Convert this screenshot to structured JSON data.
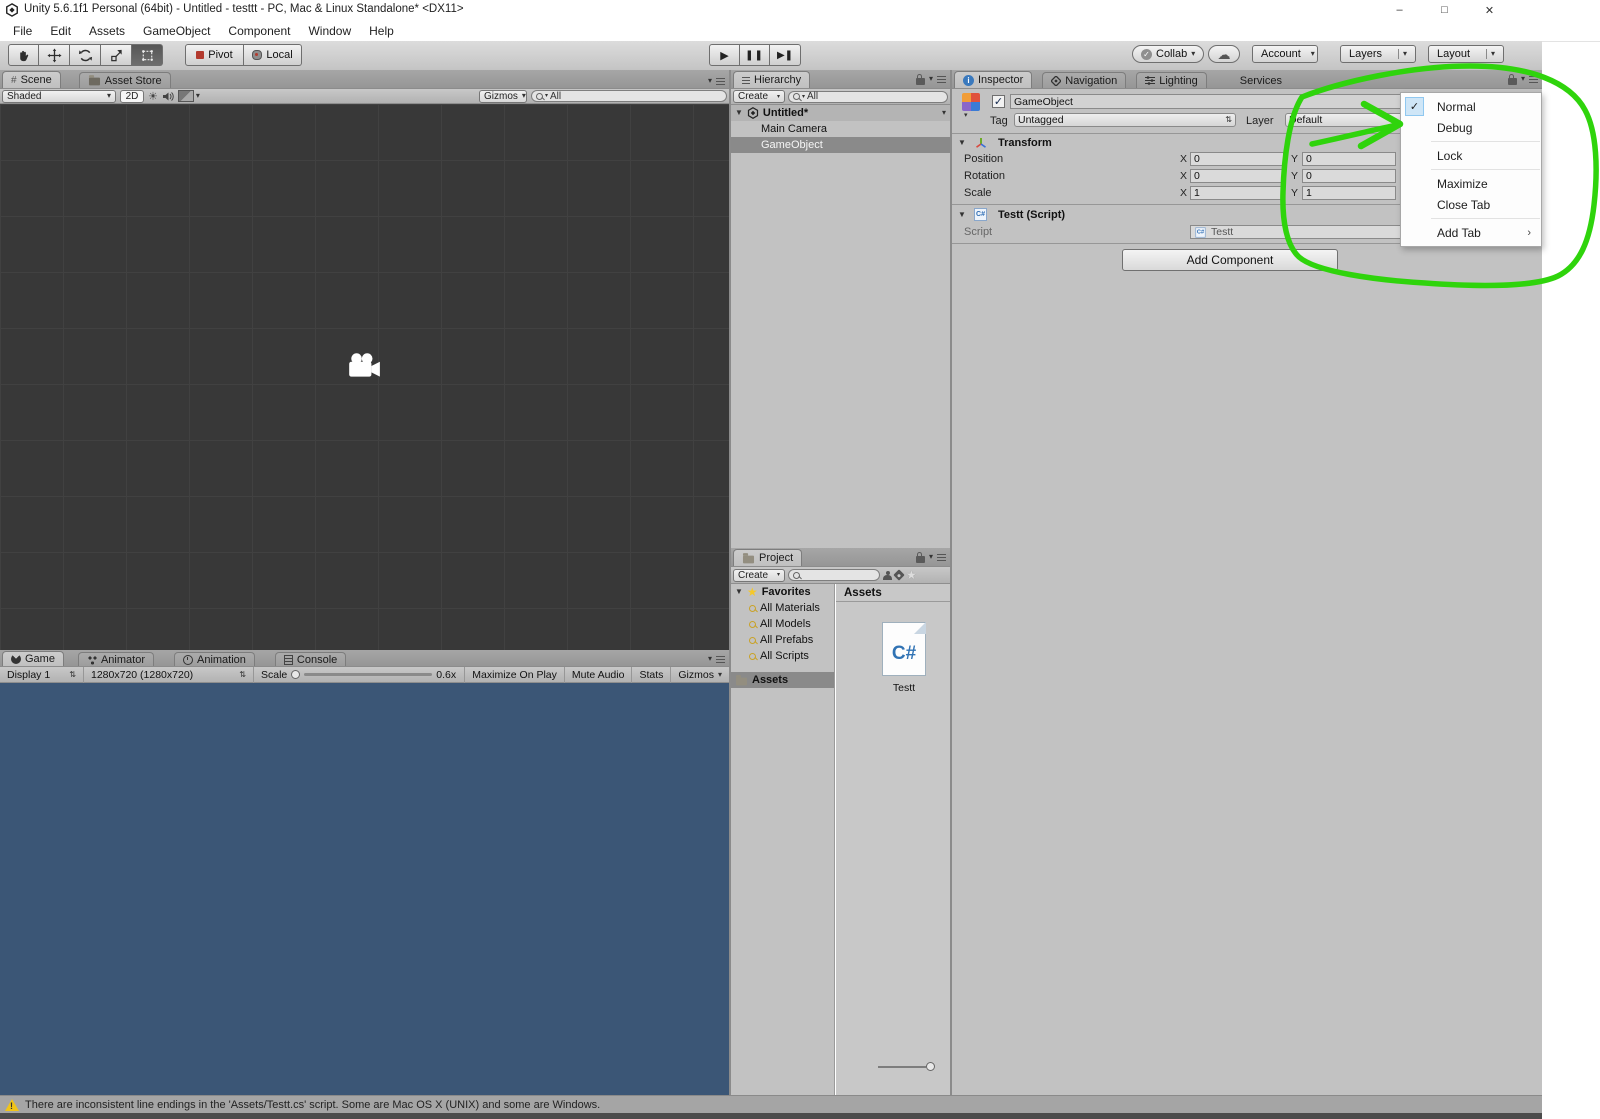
{
  "colors": {
    "annotation_green": "#2fd40c",
    "game_view_blue": "#3b5676",
    "scene_view_gray": "#383838",
    "selection_gray": "#8a8a8a",
    "menu_check_blue": "#cfe6f7"
  },
  "titlebar": {
    "title": "Unity 5.6.1f1 Personal (64bit) - Untitled - testtt - PC, Mac & Linux Standalone* <DX11>"
  },
  "menubar": {
    "items": [
      "File",
      "Edit",
      "Assets",
      "GameObject",
      "Component",
      "Window",
      "Help"
    ]
  },
  "toolbar": {
    "pivot": "Pivot",
    "local": "Local",
    "collab": "Collab",
    "account": "Account",
    "layers": "Layers",
    "layout": "Layout"
  },
  "scene_panel": {
    "tabs": [
      "Scene",
      "Asset Store"
    ],
    "shaded": "Shaded",
    "mode_2d": "2D",
    "gizmos": "Gizmos",
    "search": "All"
  },
  "hierarchy_panel": {
    "tab": "Hierarchy",
    "create": "Create",
    "search": "All",
    "scene_name": "Untitled*",
    "items": [
      "Main Camera",
      "GameObject"
    ]
  },
  "project_panel": {
    "tab": "Project",
    "create": "Create",
    "favorites": "Favorites",
    "favorite_items": [
      "All Materials",
      "All Models",
      "All Prefabs",
      "All Scripts"
    ],
    "assets_folder": "Assets",
    "assets_header": "Assets",
    "asset_file": {
      "name": "Testt",
      "type": "C#"
    }
  },
  "game_panel": {
    "tabs": [
      "Game",
      "Animator",
      "Animation",
      "Console"
    ],
    "display": "Display 1",
    "resolution": "1280x720 (1280x720)",
    "scale_label": "Scale",
    "scale_value": "0.6x",
    "buttons": [
      "Maximize On Play",
      "Mute Audio",
      "Stats",
      "Gizmos"
    ]
  },
  "inspector": {
    "tabs": [
      "Inspector",
      "Navigation",
      "Lighting",
      "Services"
    ],
    "object_name": "GameObject",
    "tag_label": "Tag",
    "tag_value": "Untagged",
    "layer_label": "Layer",
    "layer_value": "Default",
    "transform": {
      "title": "Transform",
      "axis_x": "X",
      "axis_y": "Y",
      "rows": [
        {
          "label": "Position",
          "x": "0",
          "y": "0"
        },
        {
          "label": "Rotation",
          "x": "0",
          "y": "0"
        },
        {
          "label": "Scale",
          "x": "1",
          "y": "1"
        }
      ]
    },
    "script": {
      "title": "Testt (Script)",
      "field_label": "Script",
      "field_value": "Testt"
    },
    "add_component": "Add Component"
  },
  "context_menu": {
    "items": [
      {
        "label": "Normal",
        "checked": true
      },
      {
        "label": "Debug"
      },
      {
        "label": "Lock"
      },
      {
        "label": "Maximize"
      },
      {
        "label": "Close Tab"
      },
      {
        "label": "Add Tab",
        "submenu": true
      }
    ]
  },
  "status_bar": {
    "message": "There are inconsistent line endings in the 'Assets/Testt.cs' script. Some are Mac OS X (UNIX) and some are Windows."
  }
}
